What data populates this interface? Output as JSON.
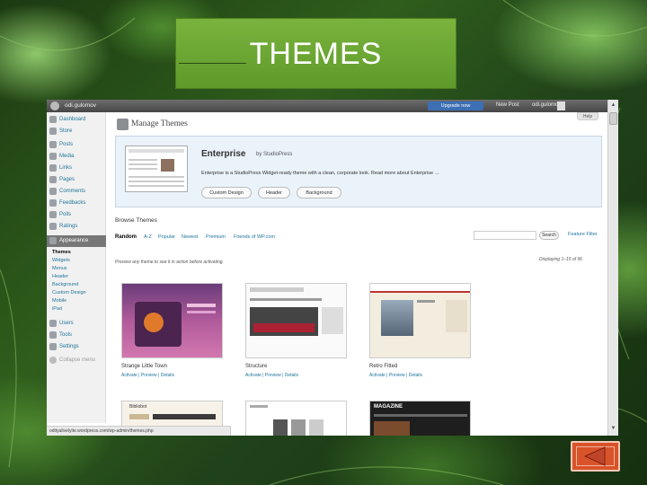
{
  "slide": {
    "title": "THEMES"
  },
  "admin_bar": {
    "site_name": "odi.gulomov",
    "upgrade_label": "Upgrade now",
    "new_post_label": "New Post",
    "user_name": "odi.gulomov",
    "logout_label": "Log Out"
  },
  "sidebar": {
    "items_top": [
      "Dashboard",
      "Store"
    ],
    "items_content": [
      "Posts",
      "Media",
      "Links",
      "Pages",
      "Comments",
      "Feedbacks",
      "Polls",
      "Ratings"
    ],
    "appearance": "Appearance",
    "appearance_sub": [
      "Themes",
      "Widgets",
      "Menus",
      "Header",
      "Background",
      "Custom Design",
      "Mobile",
      "iPad"
    ],
    "items_bottom": [
      "Users",
      "Tools",
      "Settings"
    ],
    "collapse_label": "Collapse menu"
  },
  "main": {
    "page_title": "Manage Themes",
    "help_label": "Help",
    "current_theme": {
      "name": "Enterprise",
      "by": "by StudioPress",
      "description": "Enterprise is a StudioPress Widget-ready theme with a clean, corporate look. Read more about Enterprise →",
      "buttons": [
        "Custom Design",
        "Header",
        "Background"
      ]
    },
    "browse_title": "Browse Themes",
    "tabs": [
      "Random",
      "A-Z",
      "Popular",
      "Newest",
      "Premium",
      "Friends of WP.com"
    ],
    "search_button": "Search",
    "advanced_search": "Feature Filter",
    "hint": "Preview any theme to see it in action before activating.",
    "displaying": "Displaying 1–15 of 96",
    "themes": [
      {
        "name": "Strange Little Town",
        "actions": "Activate | Preview | Details"
      },
      {
        "name": "Structure",
        "actions": "Activate | Preview | Details"
      },
      {
        "name": "Retro Fitted",
        "actions": "Activate | Preview | Details"
      },
      {
        "name": "Bibliobot",
        "actions": ""
      },
      {
        "name": "",
        "actions": ""
      },
      {
        "name": "MAGAZINE",
        "actions": ""
      }
    ]
  },
  "status_bar": {
    "url": "odityalivelyite.wordpress.com/wp-admin/themes.php"
  },
  "colors": {
    "banner": "#6aa632",
    "link": "#21759b",
    "back_button": "#d9532a"
  },
  "back_icon": "left-triangle-icon"
}
